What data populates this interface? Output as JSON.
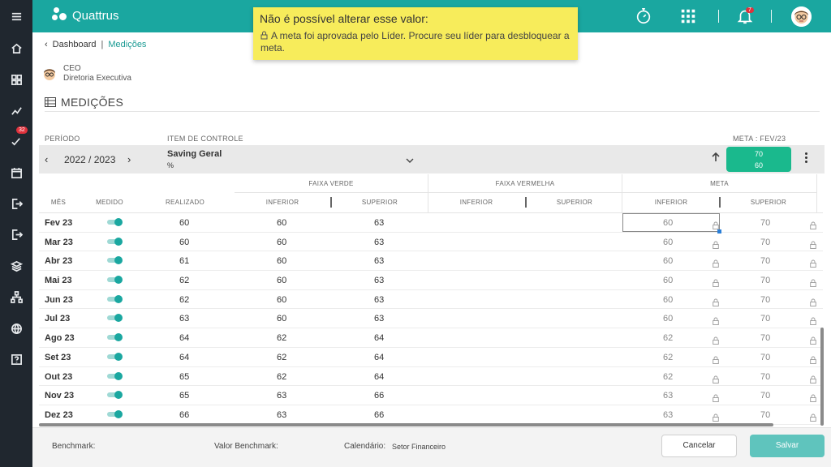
{
  "app": {
    "brand": "Quattrus"
  },
  "sidebar": {
    "badge_count": "32",
    "icons": [
      "menu-icon",
      "home-icon",
      "dashboard-icon",
      "trend-icon",
      "check-list-icon",
      "calendar-icon",
      "logout-icon",
      "exit-icon",
      "layers-icon",
      "hierarchy-icon",
      "globe-icon",
      "help-icon"
    ]
  },
  "header": {
    "notification_count": "7"
  },
  "tooltip": {
    "title": "Não é possível alterar esse valor:",
    "body": "A meta foi aprovada pelo Líder. Procure seu líder para desbloquear a meta."
  },
  "breadcrumb": {
    "parent": "Dashboard",
    "current": "Medições"
  },
  "profile": {
    "role": "CEO",
    "department": "Diretoria Executiva"
  },
  "page": {
    "title": "MEDIÇÕES"
  },
  "labels": {
    "periodo": "PERÍODO",
    "item_controle": "ITEM DE CONTROLE",
    "meta_period": "META : FEV/23"
  },
  "selection": {
    "period": "2022 / 2023",
    "item_name": "Saving Geral",
    "item_unit": "%",
    "meta_top": "70",
    "meta_bottom": "60"
  },
  "table": {
    "groups": {
      "verde": "FAIXA VERDE",
      "vermelha": "FAIXA VERMELHA",
      "meta": "META"
    },
    "columns": {
      "mes": "MÊS",
      "medido": "MEDIDO",
      "realizado": "REALIZADO",
      "inferior": "INFERIOR",
      "superior": "SUPERIOR"
    },
    "rows": [
      {
        "month": "Fev 23",
        "realizado": "60",
        "verde_inf": "60",
        "verde_sup": "63",
        "meta_inf": "60",
        "meta_sup": "70"
      },
      {
        "month": "Mar 23",
        "realizado": "60",
        "verde_inf": "60",
        "verde_sup": "63",
        "meta_inf": "60",
        "meta_sup": "70"
      },
      {
        "month": "Abr 23",
        "realizado": "61",
        "verde_inf": "60",
        "verde_sup": "63",
        "meta_inf": "60",
        "meta_sup": "70"
      },
      {
        "month": "Mai 23",
        "realizado": "62",
        "verde_inf": "60",
        "verde_sup": "63",
        "meta_inf": "60",
        "meta_sup": "70"
      },
      {
        "month": "Jun 23",
        "realizado": "62",
        "verde_inf": "60",
        "verde_sup": "63",
        "meta_inf": "60",
        "meta_sup": "70"
      },
      {
        "month": "Jul 23",
        "realizado": "63",
        "verde_inf": "60",
        "verde_sup": "63",
        "meta_inf": "60",
        "meta_sup": "70"
      },
      {
        "month": "Ago 23",
        "realizado": "64",
        "verde_inf": "62",
        "verde_sup": "64",
        "meta_inf": "62",
        "meta_sup": "70"
      },
      {
        "month": "Set 23",
        "realizado": "64",
        "verde_inf": "62",
        "verde_sup": "64",
        "meta_inf": "62",
        "meta_sup": "70"
      },
      {
        "month": "Out 23",
        "realizado": "65",
        "verde_inf": "62",
        "verde_sup": "64",
        "meta_inf": "62",
        "meta_sup": "70"
      },
      {
        "month": "Nov 23",
        "realizado": "65",
        "verde_inf": "63",
        "verde_sup": "66",
        "meta_inf": "63",
        "meta_sup": "70"
      },
      {
        "month": "Dez 23",
        "realizado": "66",
        "verde_inf": "63",
        "verde_sup": "66",
        "meta_inf": "63",
        "meta_sup": "70"
      }
    ]
  },
  "footer": {
    "benchmark": "Benchmark:",
    "valor_benchmark": "Valor Benchmark:",
    "calendario": "Calendário:",
    "calendario_value": "Setor Financeiro",
    "cancel": "Cancelar",
    "save": "Salvar"
  },
  "colors": {
    "primary": "#1aa7a0",
    "meta_box": "#1ab98d",
    "tooltip": "#f7ec5b",
    "sidebar": "#20272f"
  }
}
